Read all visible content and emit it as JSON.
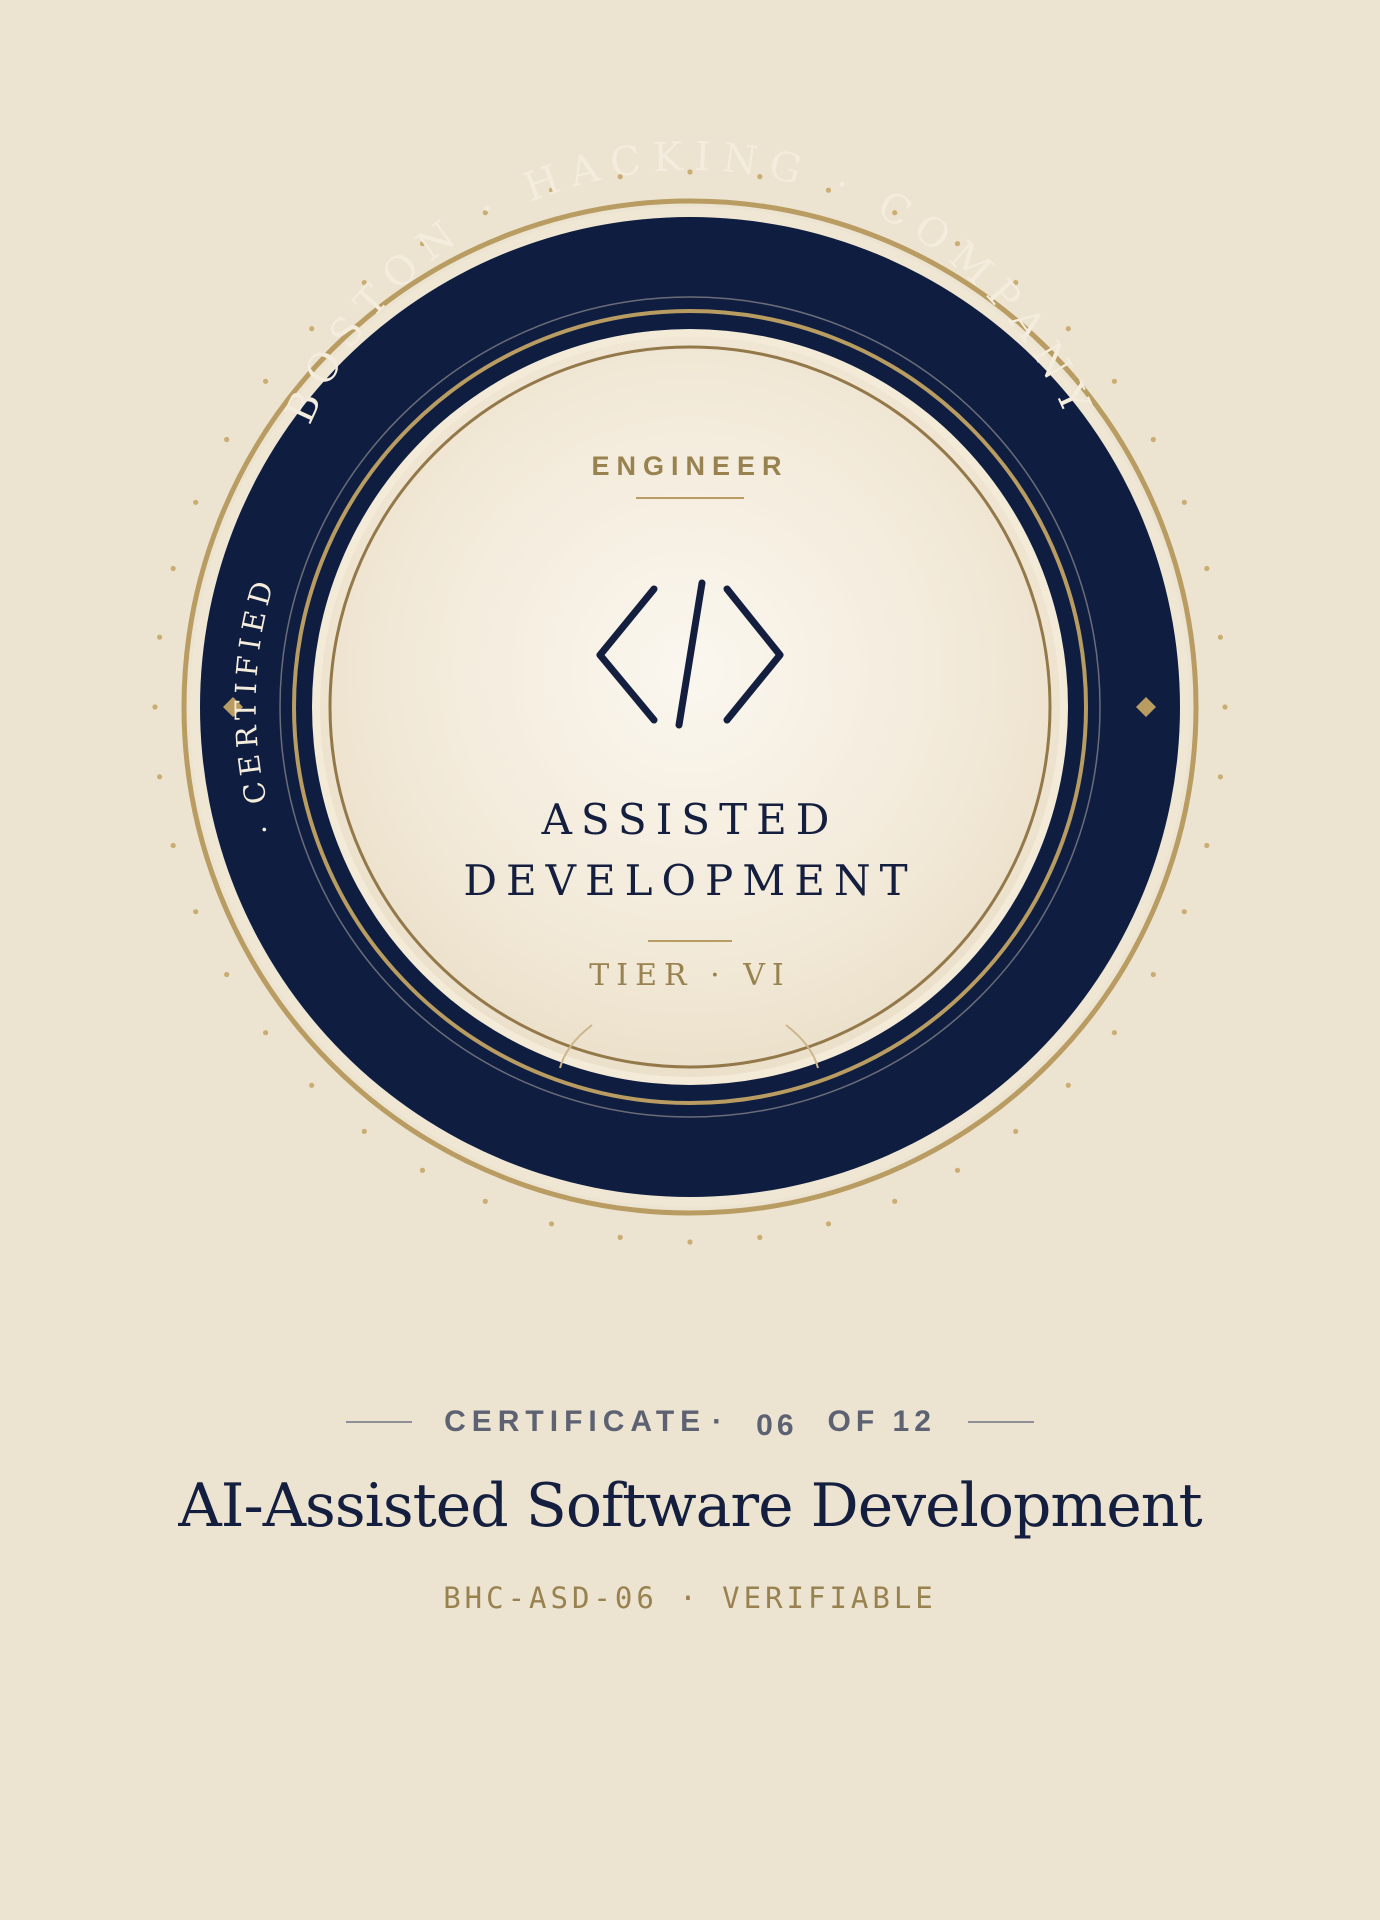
{
  "seal": {
    "arc_top": "BOSTON · HACKING · COMPANY",
    "arc_left": "· CERTIFIED",
    "role": "ENGINEER",
    "icon": "code-brackets-icon",
    "title_line1": "ASSISTED",
    "title_line2": "DEVELOPMENT",
    "tier": "TIER · VI"
  },
  "certificate": {
    "label": "CERTIFICATE",
    "separator": "·",
    "number": "06",
    "of_total": "OF 12",
    "title": "AI-Assisted Software Development",
    "code": "BHC-ASD-06 · VERIFIABLE"
  },
  "colors": {
    "background": "#ece3d1",
    "navy": "#0f1e40",
    "gold": "#b99c62",
    "inner_gold": "#93784a",
    "cream": "#f6efe1",
    "muted_text": "#5d6272",
    "code_gold": "#98824f"
  }
}
